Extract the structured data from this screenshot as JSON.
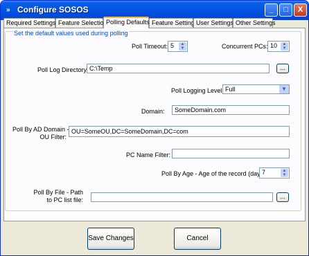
{
  "window": {
    "title": "Configure SOSOS",
    "minimize": "_",
    "maximize": "□",
    "close": "X"
  },
  "tabs": [
    {
      "label": "Required Settings"
    },
    {
      "label": "Feature Selection"
    },
    {
      "label": "Polling Defaults"
    },
    {
      "label": "Feature Settings"
    },
    {
      "label": "User Settings"
    },
    {
      "label": "Other Settings"
    }
  ],
  "active_tab": "Polling Defaults",
  "group": {
    "legend": "Set the default values used during polling"
  },
  "form": {
    "poll_timeout": {
      "label": "Poll Timeout:",
      "value": "5"
    },
    "concurrent_pcs": {
      "label": "Concurrent PCs:",
      "value": "10"
    },
    "poll_log_directory": {
      "label": "Poll Log Directory:",
      "value": "C:\\Temp",
      "browse": "..."
    },
    "poll_logging_level": {
      "label": "Poll Logging Level:",
      "value": "Full"
    },
    "domain": {
      "label": "Domain:",
      "value": "SomeDomain.com"
    },
    "ad_ou_filter": {
      "label_line1": "Poll By AD Domain -",
      "label_line2": "OU Filter:",
      "value": "OU=SomeOU,DC=SomeDomain,DC=com"
    },
    "pc_name_filter": {
      "label": "PC Name Filter:",
      "value": ""
    },
    "poll_by_age": {
      "label": "Poll By Age - Age of the record (days):",
      "value": "7"
    },
    "pc_list_file": {
      "label_line1": "Poll By File - Path",
      "label_line2": "to PC list file:",
      "value": "",
      "browse": "..."
    }
  },
  "buttons": {
    "save": "Save Changes",
    "cancel": "Cancel"
  },
  "icons": {
    "app": "app-icon",
    "spin": "spin-arrows-icon",
    "dropdown": "chevron-down-icon"
  }
}
